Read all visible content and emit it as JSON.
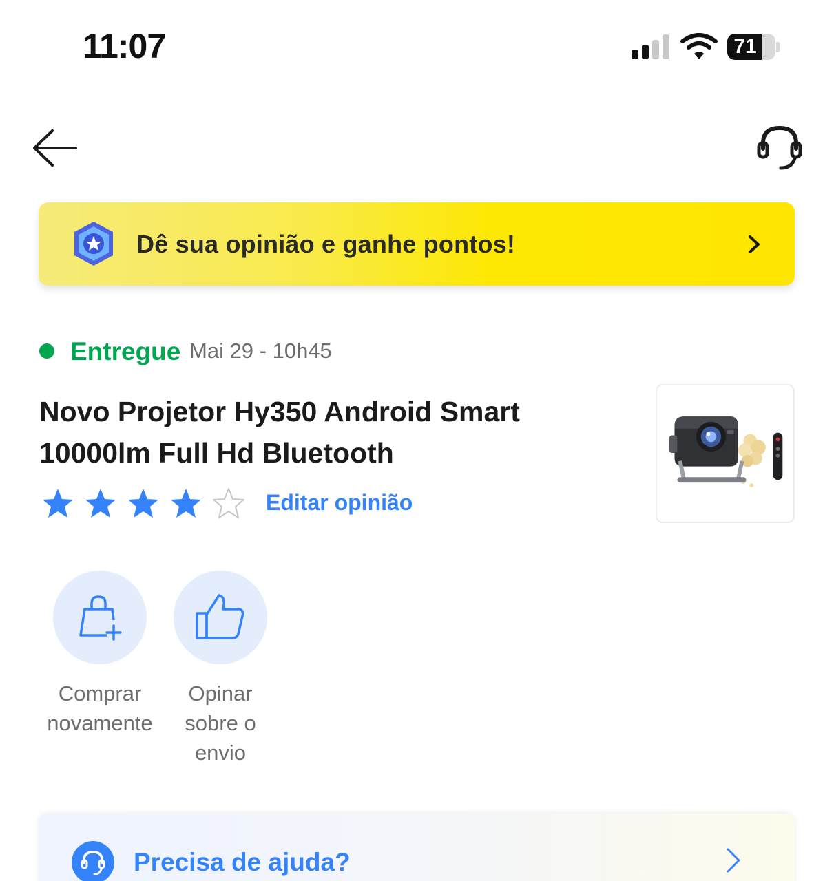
{
  "status_bar": {
    "time": "11:07",
    "battery_level": "71",
    "battery_fraction": 0.71,
    "signal_bars_active": 2,
    "signal_bars_total": 4
  },
  "nav": {
    "back_icon": "arrow-left-icon",
    "support_icon": "headset-icon"
  },
  "promo": {
    "text": "Dê sua opinião e ganhe pontos!",
    "badge_icon": "star-badge-icon",
    "chevron_icon": "chevron-right-icon"
  },
  "order": {
    "status": "Entregue",
    "date": "Mai 29 - 10h45",
    "status_color": "#00a650"
  },
  "product": {
    "title": "Novo Projetor Hy350 Android Smart 10000lm Full Hd Bluetooth",
    "rating": 4,
    "rating_max": 5,
    "edit_review_label": "Editar opinião",
    "image_icon": "projector-product-image"
  },
  "actions": [
    {
      "label": "Comprar novamente",
      "icon": "shopping-bag-plus-icon"
    },
    {
      "label": "Opinar sobre o envio",
      "icon": "thumbs-up-icon"
    }
  ],
  "help": {
    "label": "Precisa de ajuda?",
    "icon": "headset-icon",
    "chevron_icon": "chevron-right-icon"
  },
  "colors": {
    "accent_blue": "#3483fa",
    "promo_yellow": "#fee600",
    "success_green": "#00a650"
  }
}
